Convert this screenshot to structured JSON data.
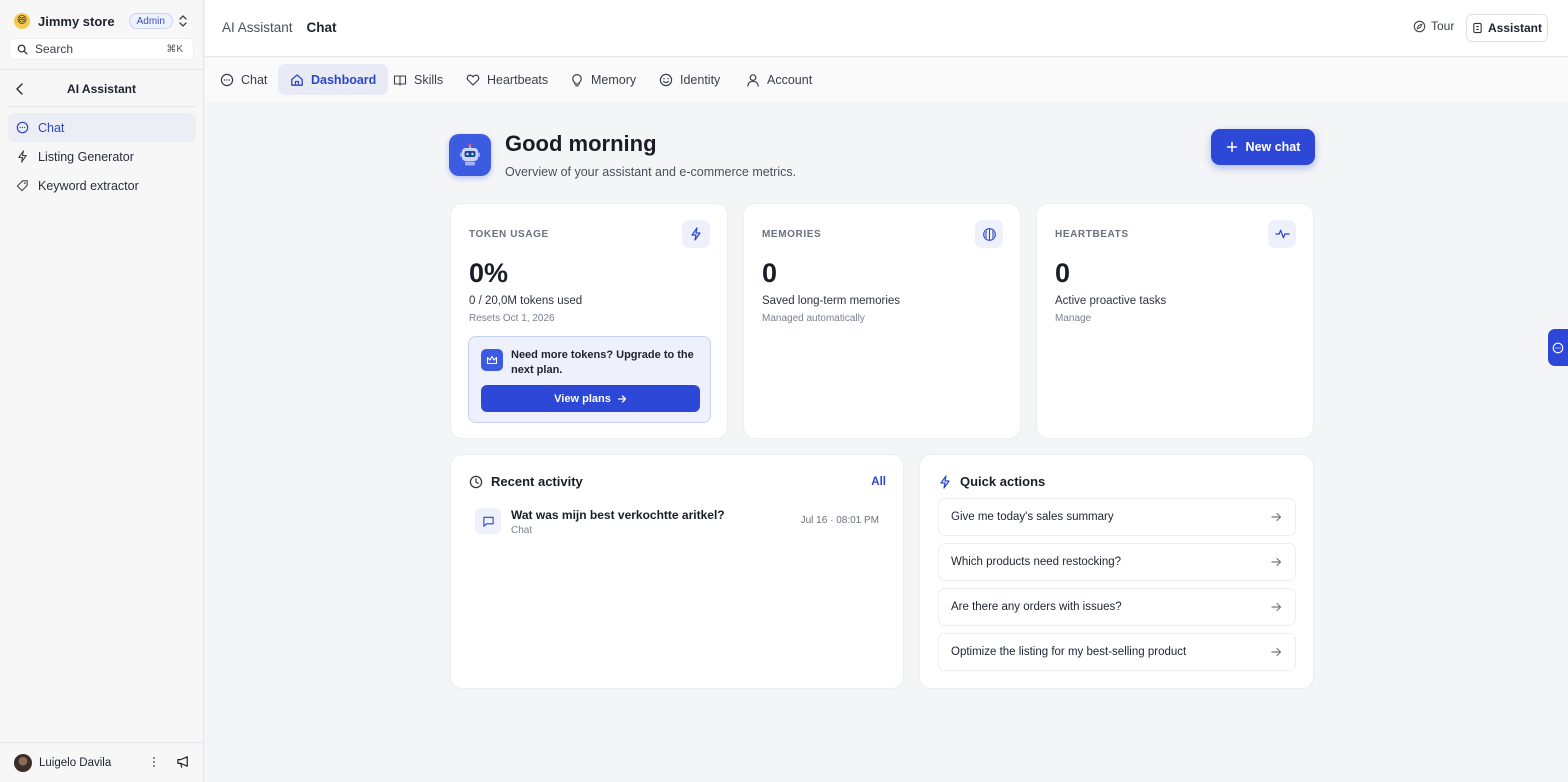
{
  "sidebar": {
    "store_name": "Jimmy store",
    "store_emoji": "😄",
    "role_badge": "Admin",
    "search_label": "Search",
    "search_shortcut": "⌘K",
    "section_title": "AI Assistant",
    "items": [
      {
        "label": "Chat",
        "icon": "chat-bubble-icon",
        "active": true
      },
      {
        "label": "Listing Generator",
        "icon": "lightning-icon",
        "active": false
      },
      {
        "label": "Keyword extractor",
        "icon": "tag-icon",
        "active": false
      }
    ],
    "user_name": "Luigelo Davila"
  },
  "header": {
    "breadcrumb_parent": "AI Assistant",
    "breadcrumb_current": "Chat",
    "tour_label": "Tour",
    "assistant_label": "Assistant"
  },
  "tabs": [
    {
      "label": "Chat",
      "icon": "chat-bubble-icon",
      "active": false
    },
    {
      "label": "Dashboard",
      "icon": "home-icon",
      "active": true
    },
    {
      "label": "Skills",
      "icon": "book-icon",
      "active": false
    },
    {
      "label": "Heartbeats",
      "icon": "heart-icon",
      "active": false
    },
    {
      "label": "Memory",
      "icon": "lightbulb-icon",
      "active": false
    },
    {
      "label": "Identity",
      "icon": "smiley-icon",
      "active": false
    },
    {
      "label": "Account",
      "icon": "user-icon",
      "active": false
    }
  ],
  "hero": {
    "title": "Good morning",
    "subtitle": "Overview of your assistant and e-commerce metrics.",
    "new_chat_label": "New chat"
  },
  "stats": {
    "tokens": {
      "label": "TOKEN USAGE",
      "value": "0%",
      "desc": "0 / 20,0M tokens used",
      "note": "Resets Oct 1, 2026",
      "upgrade_text": "Need more tokens? Upgrade to the next plan.",
      "upgrade_button": "View plans"
    },
    "memories": {
      "label": "MEMORIES",
      "value": "0",
      "desc": "Saved long-term memories",
      "note": "Managed automatically"
    },
    "heartbeats": {
      "label": "HEARTBEATS",
      "value": "0",
      "desc": "Active proactive tasks",
      "note": "Manage"
    }
  },
  "recent": {
    "title": "Recent activity",
    "all_label": "All",
    "items": [
      {
        "title": "Wat was mijn best verkochtte aritkel?",
        "type": "Chat",
        "time": "Jul 16 · 08:01 PM"
      }
    ]
  },
  "quick_actions": {
    "title": "Quick actions",
    "items": [
      "Give me today's sales summary",
      "Which products need restocking?",
      "Are there any orders with issues?",
      "Optimize the listing for my best-selling product"
    ]
  },
  "colors": {
    "accent": "#2d47d6",
    "accent_light": "#eef1fb",
    "sidebar_bg": "#f7f7f8",
    "page_bg": "#f4f5f7"
  }
}
